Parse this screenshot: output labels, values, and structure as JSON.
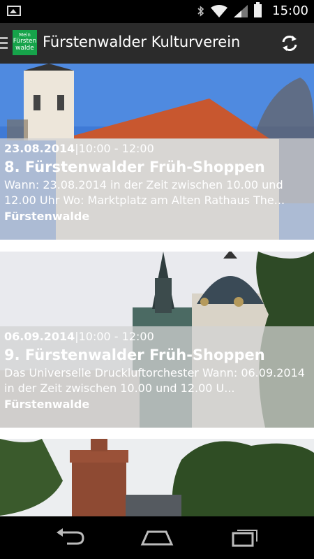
{
  "status": {
    "time": "15:00"
  },
  "appbar": {
    "logo_text": [
      "Mein",
      "Fürsten",
      "walde"
    ],
    "title": "Fürstenwalder Kulturverein"
  },
  "events": [
    {
      "date": "23.08.2014",
      "time": "|10:00 - 12:00",
      "title": "8. Fürstenwalder Früh-Shoppen",
      "description": "Wann: 23.08.2014 in der Zeit zwischen 10.00 und 12.00 Uhr  Wo: Marktplatz am Alten Rathaus   The...",
      "location": "Fürstenwalde"
    },
    {
      "date": "06.09.2014",
      "time": "|10:00 - 12:00",
      "title": "9. Fürstenwalder Früh-Shoppen",
      "description": "Das Universelle Druckluftorchester Wann: 06.09.2014 in der Zeit zwischen 10.00 und 12.00 U...",
      "location": "Fürstenwalde"
    }
  ],
  "colors": {
    "appbar": "#2b2b2b",
    "logo": "#16a34a",
    "overlay": "rgba(210,210,210,0.74)"
  }
}
